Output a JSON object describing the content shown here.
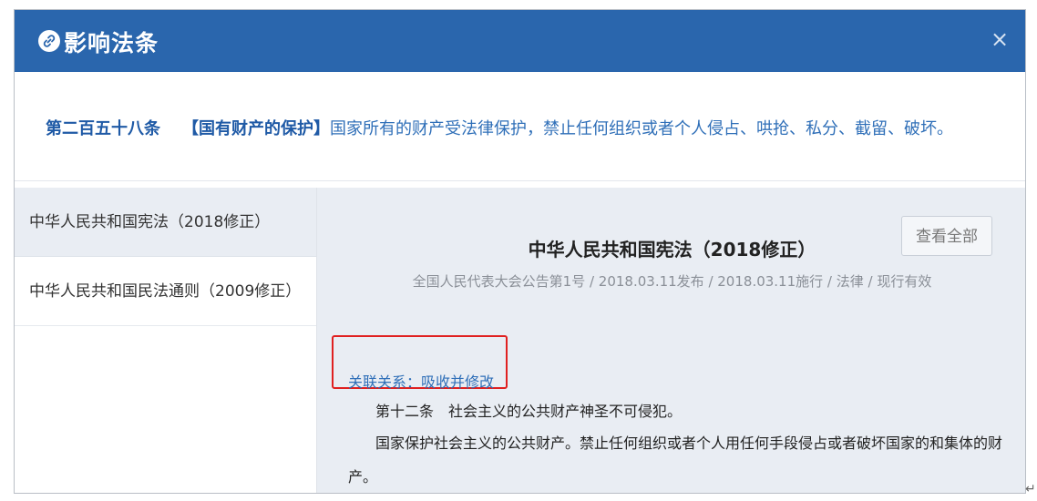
{
  "header": {
    "title": "影响法条",
    "logo_icon": "link-icon",
    "close_label": "×"
  },
  "clause": {
    "number": "第二百五十八条",
    "tag": "【国有财产的保护】",
    "text": "国家所有的财产受法律保护，禁止任何组织或者个人侵占、哄抢、私分、截留、破坏。"
  },
  "sidebar": {
    "items": [
      {
        "label": "中华人民共和国宪法（2018修正）",
        "active": true
      },
      {
        "label": "中华人民共和国民法通则（2009修正）",
        "active": false
      }
    ]
  },
  "document": {
    "title": "中华人民共和国宪法（2018修正）",
    "view_all_label": "查看全部",
    "meta": "全国人民代表大会公告第1号 / 2018.03.11发布 / 2018.03.11施行 / 法律 / 现行有效",
    "relation": "关联关系：吸收并修改",
    "paragraphs": [
      "第十二条　社会主义的公共财产神圣不可侵犯。",
      "国家保护社会主义的公共财产。禁止任何组织或者个人用任何手段侵占或者破坏国家的和集体的财",
      "产。"
    ]
  },
  "colors": {
    "header_bg": "#2a66ad",
    "accent_blue": "#2f6fb8",
    "highlight_red": "#e02020",
    "content_bg": "#e9edf3"
  },
  "corner_glyph": "↵"
}
